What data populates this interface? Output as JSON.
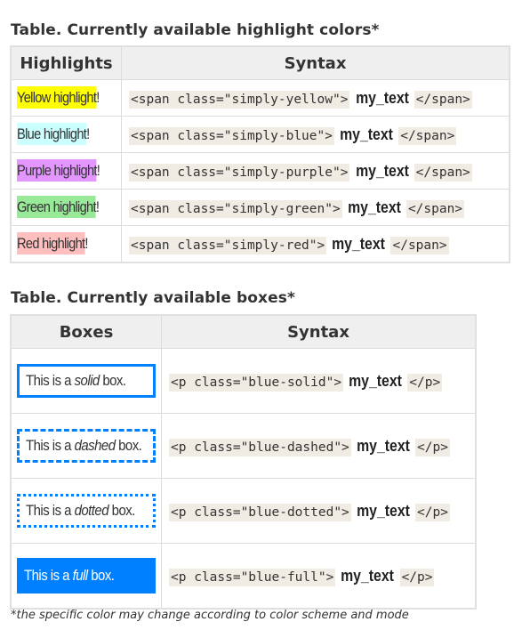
{
  "highlights_table": {
    "caption": "Table. Currently available highlight colors*",
    "headers": [
      "Highlights",
      "Syntax"
    ],
    "rows": [
      {
        "label": "Yellow highlight",
        "suffix": "!",
        "color": "#ffff00",
        "code_open": "<span class=\"simply-yellow\">",
        "content": "my_text",
        "code_close": "</span>"
      },
      {
        "label": "Blue highlight",
        "suffix": "!",
        "color": "#ccffff",
        "code_open": "<span class=\"simply-blue\">",
        "content": "my_text",
        "code_close": "</span>"
      },
      {
        "label": "Purple highlight",
        "suffix": "!",
        "color": "#e396ff",
        "code_open": "<span class=\"simply-purple\">",
        "content": "my_text",
        "code_close": "</span>"
      },
      {
        "label": "Green highlight",
        "suffix": "!",
        "color": "#98e998",
        "code_open": "<span class=\"simply-green\">",
        "content": "my_text",
        "code_close": "</span>"
      },
      {
        "label": "Red highlight",
        "suffix": "!",
        "color": "#ffbfbf",
        "code_open": "<span class=\"simply-red\">",
        "content": "my_text",
        "code_close": "</span>"
      }
    ]
  },
  "boxes_table": {
    "caption": "Table. Currently available boxes*",
    "headers": [
      "Boxes",
      "Syntax"
    ],
    "accent_color": "#0080ff",
    "rows": [
      {
        "prefix": "This is a ",
        "style_word": "solid",
        "suffix": " box.",
        "code_open": "<p class=\"blue-solid\">",
        "content": "my_text",
        "code_close": "</p>"
      },
      {
        "prefix": "This is a ",
        "style_word": "dashed",
        "suffix": " box.",
        "code_open": "<p class=\"blue-dashed\">",
        "content": "my_text",
        "code_close": "</p>"
      },
      {
        "prefix": "This is a ",
        "style_word": "dotted",
        "suffix": " box.",
        "code_open": "<p class=\"blue-dotted\">",
        "content": "my_text",
        "code_close": "</p>"
      },
      {
        "prefix": "This is a ",
        "style_word": "full",
        "suffix": " box.",
        "code_open": "<p class=\"blue-full\">",
        "content": "my_text",
        "code_close": "</p>"
      }
    ]
  },
  "footnote": "*the specific color may change according to color scheme and mode"
}
